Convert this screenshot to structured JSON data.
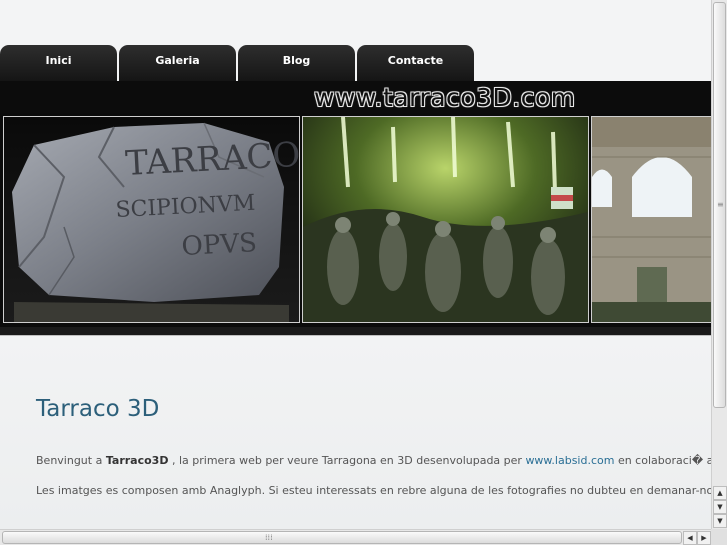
{
  "nav": {
    "tabs": [
      {
        "label": "Inici"
      },
      {
        "label": "Galeria"
      },
      {
        "label": "Blog"
      },
      {
        "label": "Contacte"
      }
    ]
  },
  "header": {
    "site_title": "www.tarraco3D.com"
  },
  "gallery": {
    "photo1_inscription": [
      "TARRACO",
      "SCIPIONVM",
      "OPVS"
    ]
  },
  "main": {
    "heading": "Tarraco 3D",
    "p1": {
      "before": "Benvingut a ",
      "bold": "Tarraco3D",
      "middle": " , la primera web per veure Tarragona en 3D desenvolupada per ",
      "link": "www.labsid.com",
      "after": " en colaboraci� amb AvResear"
    },
    "p2": "Les imatges es composen amb Anaglyph. Si esteu interessats en rebre alguna de les fotografies no dubteu en demanar-nos-la a meninar"
  },
  "colors": {
    "heading": "#2c5f7a",
    "link": "#2a6f95",
    "tab_bg": "#1e1e1e"
  }
}
